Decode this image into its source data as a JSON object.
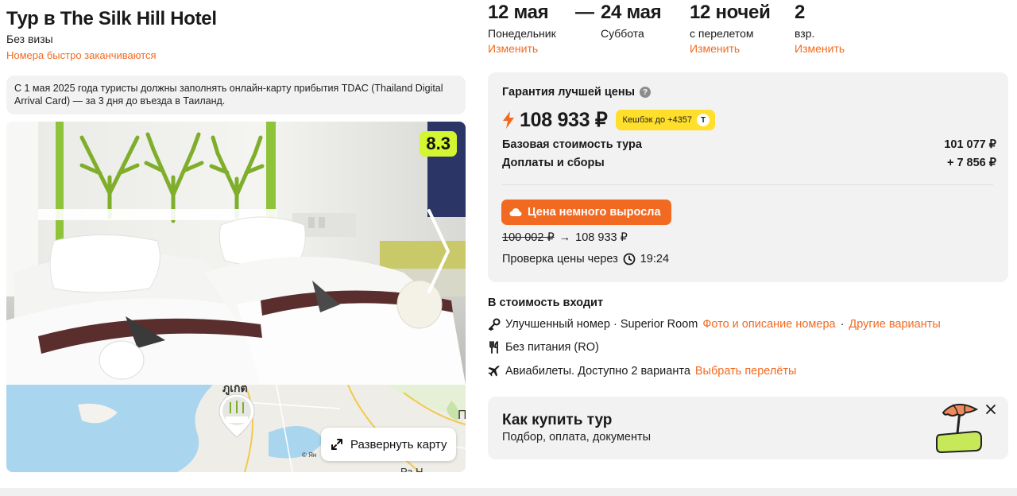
{
  "hotel": {
    "title": "Тур в The Silk Hill Hotel",
    "visa": "Без визы",
    "scarcity": "Номера быстро заканчиваются",
    "notice": "С 1 мая 2025 года туристы должны заполнять онлайн-карту прибытия TDAC (Thailand Digital Arrival Card) — за 3 дня до въезда в Таиланд.",
    "rating": "8.3"
  },
  "map": {
    "expand_label": "Развернуть карту",
    "copyright": "© Ян",
    "labels": [
      "ภูเก็ต",
      "П",
      "Ра Н"
    ]
  },
  "dates": {
    "start": {
      "date": "12 мая",
      "weekday": "Понедельник",
      "edit": "Изменить"
    },
    "dash": "—",
    "end": {
      "date": "24 мая",
      "weekday": "Суббота"
    },
    "nights": {
      "value": "12 ночей",
      "sub": "с перелетом",
      "edit": "Изменить"
    },
    "guests": {
      "value": "2",
      "sub": "взр.",
      "edit": "Изменить"
    }
  },
  "price": {
    "guarantee": "Гарантия лучшей цены",
    "total": "108 933 ₽",
    "cashback": "Кешбэк до +4357",
    "cashback_badge": "Т",
    "base_label": "Базовая стоимость тура",
    "base_value": "101 077 ₽",
    "fees_label": "Доплаты и сборы",
    "fees_value": "+ 7 856 ₽",
    "rise_badge": "Цена немного выросла",
    "old_price": "100 002 ₽",
    "arrow": "→",
    "new_price": "108 933 ₽",
    "check_label": "Проверка цены через",
    "check_timer": "19:24"
  },
  "includes": {
    "title": "В стоимость входит",
    "room_text": "Улучшенный номер · Superior Room",
    "room_link": "Фото и описание номера",
    "room_sep": "·",
    "room_other": "Другие варианты",
    "meal": "Без питания (RO)",
    "flights_text": "Авиабилеты. Доступно 2 варианта",
    "flights_link": "Выбрать перелёты"
  },
  "howto": {
    "title": "Как купить тур",
    "subtitle": "Подбор, оплата, документы"
  },
  "colors": {
    "accent": "#f26a21",
    "rating_bg": "#d4f531",
    "cashback_bg": "#ffdf2b",
    "card_bg": "#f2f2f2"
  },
  "icons": [
    "question-icon",
    "bolt-icon",
    "cloud-icon",
    "clock-icon",
    "key-icon",
    "cutlery-icon",
    "plane-icon",
    "expand-icon",
    "close-icon",
    "chevron-right-icon",
    "map-pin-icon",
    "beach-umbrella-icon"
  ]
}
